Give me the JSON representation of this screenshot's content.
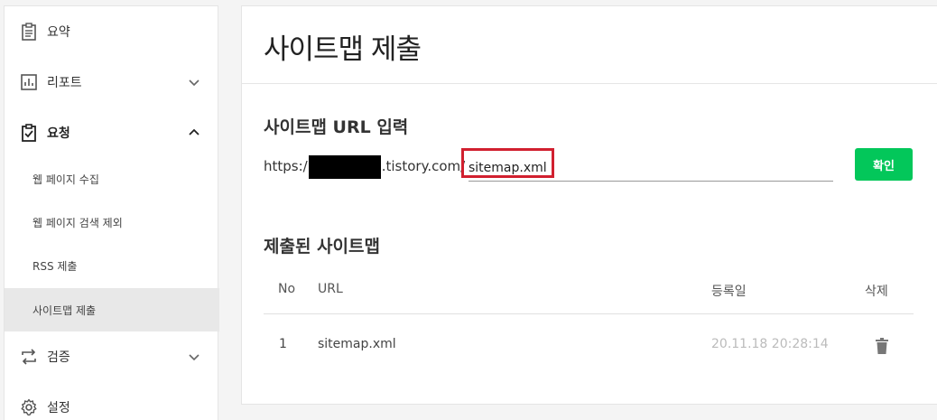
{
  "sidebar": {
    "items": [
      {
        "label": "요약",
        "icon": "clipboard-list-icon"
      },
      {
        "label": "리포트",
        "icon": "bar-chart-icon"
      },
      {
        "label": "요청",
        "icon": "clipboard-check-icon"
      },
      {
        "label": "웹 페이지 수집"
      },
      {
        "label": "웹 페이지 검색 제외"
      },
      {
        "label": "RSS 제출"
      },
      {
        "label": "사이트맵 제출"
      },
      {
        "label": "검증",
        "icon": "swap-arrows-icon"
      },
      {
        "label": "설정",
        "icon": "gear-icon"
      }
    ]
  },
  "main": {
    "title": "사이트맵 제출",
    "url_section": {
      "title": "사이트맵 URL 입력",
      "prefix_start": "https:/",
      "prefix_end": ".tistory.com/",
      "input_value": "sitemap.xml",
      "confirm_label": "확인"
    },
    "submitted": {
      "title": "제출된 사이트맵",
      "headers": {
        "no": "No",
        "url": "URL",
        "date": "등록일",
        "delete": "삭제"
      },
      "rows": [
        {
          "no": "1",
          "url": "sitemap.xml",
          "date": "20.11.18 20:28:14"
        }
      ]
    }
  },
  "colors": {
    "accent": "#03c75a",
    "highlight": "#d1202f"
  }
}
